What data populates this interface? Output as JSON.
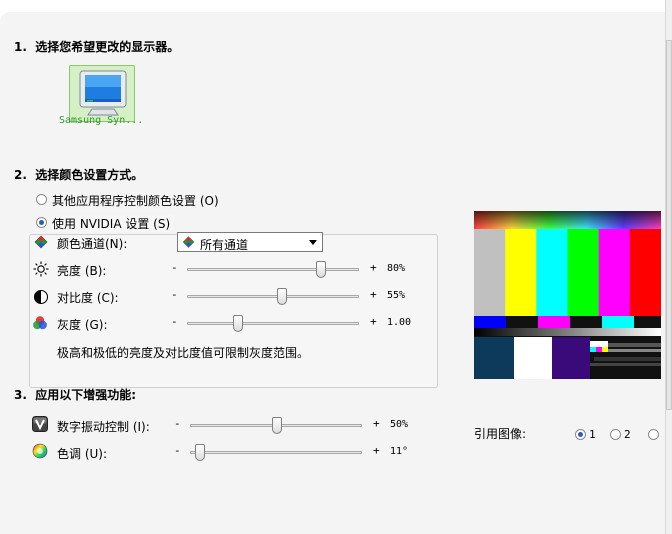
{
  "section1": {
    "num": "1.",
    "title": "选择您希望更改的显示器。",
    "monitor_name": "Samsung Syn..."
  },
  "section2": {
    "num": "2.",
    "title": "选择颜色设置方式。",
    "radio_other": "其他应用程序控制颜色设置 (O)",
    "radio_nvidia": "使用 NVIDIA 设置 (S)",
    "channel_label": "颜色通道(N):",
    "channel_value": "所有通道",
    "brightness_label": "亮度 (B):",
    "brightness_value": "80%",
    "brightness_level": 0.8,
    "contrast_label": "对比度 (C):",
    "contrast_value": "55%",
    "contrast_level": 0.55,
    "gamma_label": "灰度 (G):",
    "gamma_value": "1.00",
    "note": "极高和极低的亮度及对比度值可限制灰度范围。"
  },
  "section3": {
    "num": "3.",
    "title": "应用以下增强功能:",
    "vibrance_label": "数字振动控制 (I):",
    "vibrance_value": "50%",
    "hue_label": "色调 (U):",
    "hue_value": "11°"
  },
  "reference": {
    "label": "引用图像:",
    "options": [
      "1",
      "2"
    ],
    "selected": "1"
  },
  "controls": {
    "minus": "-",
    "plus": "+"
  },
  "colors": {
    "bars": [
      "#c0c0c0",
      "#ffff00",
      "#00ffff",
      "#00ff00",
      "#ff00ff",
      "#ff0000"
    ],
    "radio_dot": "#2a5dba",
    "monitor_tile_bg": "#d6f0c6",
    "monitor_name_text": "#2e9a2e"
  }
}
